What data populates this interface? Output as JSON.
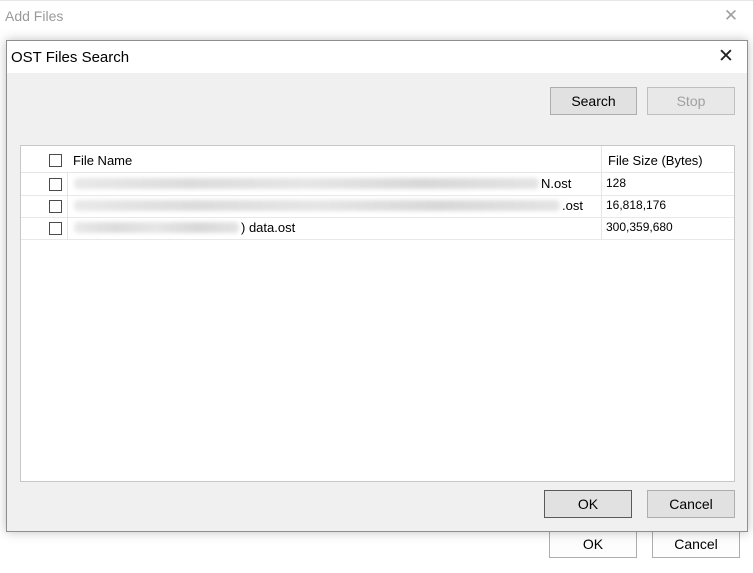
{
  "background_window": {
    "title": "Add Files",
    "ok_label": "OK",
    "cancel_label": "Cancel"
  },
  "dialog": {
    "title": "OST Files Search",
    "search_label": "Search",
    "stop_label": "Stop",
    "ok_label": "OK",
    "cancel_label": "Cancel"
  },
  "table": {
    "columns": [
      "File Name",
      "File Size (Bytes)"
    ],
    "rows": [
      {
        "name_suffix": "N.ost",
        "size": "128"
      },
      {
        "name_suffix": ".ost",
        "size": "16,818,176"
      },
      {
        "name_suffix": ") data.ost",
        "size": "300,359,680"
      }
    ]
  },
  "colors": {
    "dialog_bg": "#f0f0f0",
    "default_button_border": "#0078d7"
  }
}
